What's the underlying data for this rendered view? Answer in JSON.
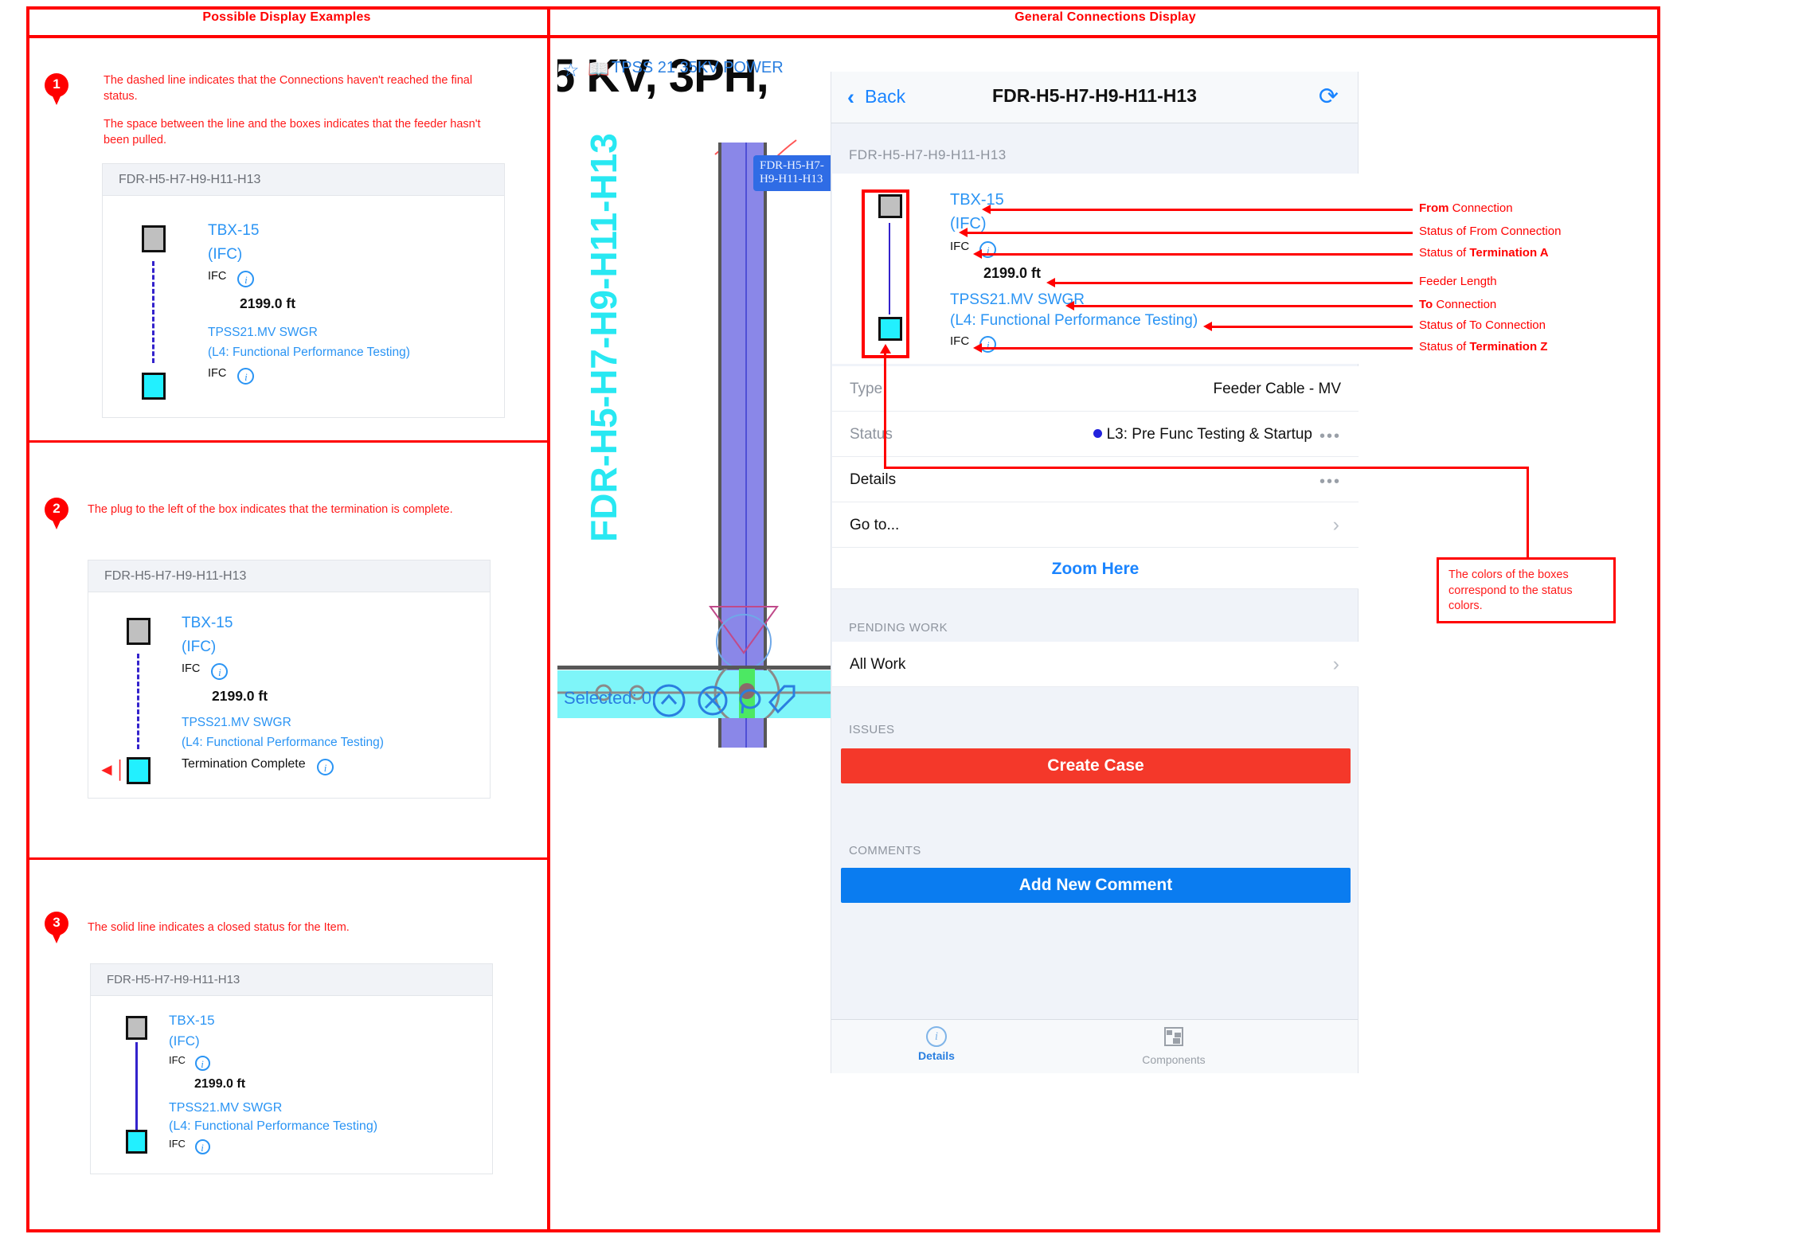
{
  "headers": {
    "left": "Possible Display Examples",
    "right": "General Connections Display"
  },
  "colors": {
    "annotation_red": "#ff0000",
    "link_blue": "#2a94f4",
    "ios_blue": "#1a84ff",
    "status_dot_blue": "#2222dd",
    "termination_a_box": "#c0c0c0",
    "termination_z_box": "#22f0ff",
    "connection_line": "#3322cc",
    "create_case_button": "#f4382a",
    "add_comment_button": "#0a7cf0"
  },
  "examples": [
    {
      "number": "1",
      "notes": [
        "The dashed line indicates that the Connections haven't reached the final status.",
        "The space between the line and the boxes indicates that the feeder hasn't been pulled."
      ],
      "card": {
        "title": "FDR-H5-H7-H9-H11-H13",
        "from_name": "TBX-15",
        "from_status": "(IFC)",
        "from_termination": "IFC",
        "length": "2199.0 ft",
        "to_name": "TPSS21.MV SWGR",
        "to_status": "(L4: Functional Performance Testing)",
        "to_termination": "IFC",
        "line_style": "dashed",
        "plug": false
      }
    },
    {
      "number": "2",
      "notes": [
        "The plug to the left of the box indicates that the termination is complete."
      ],
      "card": {
        "title": "FDR-H5-H7-H9-H11-H13",
        "from_name": "TBX-15",
        "from_status": "(IFC)",
        "from_termination": "IFC",
        "length": "2199.0 ft",
        "to_name": "TPSS21.MV SWGR",
        "to_status": "(L4: Functional Performance Testing)",
        "to_termination": "Termination Complete",
        "line_style": "dashed",
        "plug": true
      }
    },
    {
      "number": "3",
      "notes": [
        "The solid line indicates a closed status for the Item."
      ],
      "card": {
        "title": "FDR-H5-H7-H9-H11-H13",
        "from_name": "TBX-15",
        "from_status": "(IFC)",
        "from_termination": "IFC",
        "length": "2199.0 ft",
        "to_name": "TPSS21.MV SWGR",
        "to_status": "(L4: Functional Performance Testing)",
        "to_termination": "IFC",
        "line_style": "solid",
        "plug": false
      }
    }
  ],
  "cad": {
    "big_text": "5 KV, 3PH,",
    "blue_text": "TPSS 21 35KV POWER",
    "duct_tag": "FDR-H5-H7-H9-H11-H13",
    "vertical_label": "FDR-H5-H7-H9-H11-H13",
    "selected_text": "Selected: 0"
  },
  "phone": {
    "nav": {
      "back": "Back",
      "title": "FDR-H5-H7-H9-H11-H13",
      "refresh_icon": "refresh-icon"
    },
    "connection": {
      "header": "FDR-H5-H7-H9-H11-H13",
      "from_name": "TBX-15",
      "from_status": "(IFC)",
      "from_termination": "IFC",
      "length": "2199.0 ft",
      "to_name": "TPSS21.MV SWGR",
      "to_status": "(L4: Functional Performance Testing)",
      "to_termination": "IFC"
    },
    "detail_rows": [
      {
        "label": "Type",
        "value": "Feeder Cable - MV"
      },
      {
        "label": "Status",
        "value": "L3: Pre Func Testing & Startup"
      }
    ],
    "details_row": "Details",
    "goto_row": "Go to...",
    "zoom_here": "Zoom Here",
    "pending_work_header": "PENDING WORK",
    "all_work": "All Work",
    "issues_header": "ISSUES",
    "create_case": "Create Case",
    "comments_header": "COMMENTS",
    "add_comment": "Add New Comment",
    "tabs": [
      {
        "label": "Details",
        "icon": "info-icon",
        "active": true
      },
      {
        "label": "Components",
        "icon": "components-icon",
        "active": false
      }
    ]
  },
  "annotations": {
    "list": [
      {
        "bold": "From",
        "rest": " Connection"
      },
      {
        "bold": "",
        "rest": "Status of From Connection"
      },
      {
        "bold": "",
        "rest": "Status of ",
        "bold2": "Termination A"
      },
      {
        "bold": "",
        "rest": "Feeder Length"
      },
      {
        "bold": "To",
        "rest": " Connection"
      },
      {
        "bold": "",
        "rest": "Status of To Connection"
      },
      {
        "bold": "",
        "rest": "Status of ",
        "bold2": "Termination Z"
      }
    ],
    "callout_box": "The colors of the boxes correspond to the status colors."
  }
}
